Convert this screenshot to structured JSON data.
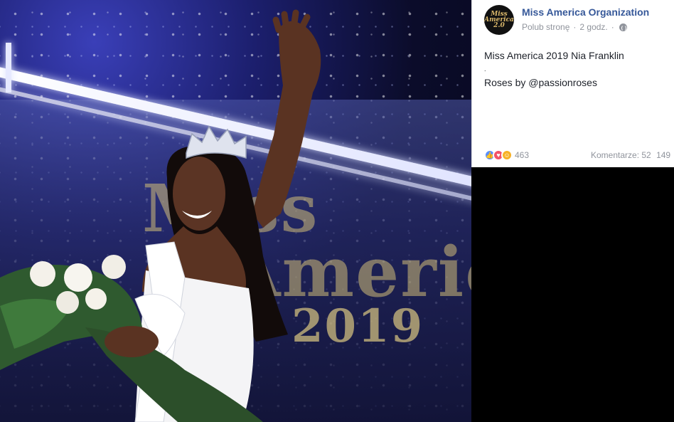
{
  "post": {
    "page_name": "Miss America Organization",
    "avatar_text": [
      "Miss",
      "America",
      "2.0"
    ],
    "like_page": "Polub stronę",
    "separator": "·",
    "time": "2 godz.",
    "privacy_icon": "globe-icon",
    "text_line1": "Miss America 2019 Nia Franklin",
    "text_line2": ".",
    "text_line3": "Roses by @passionroses",
    "reaction_icons": [
      "like-icon",
      "love-icon",
      "haha-icon"
    ],
    "reaction_count": "463",
    "comments_label": "Komentarze: 52",
    "shares_partial": "149"
  },
  "photo": {
    "stage_logo_line1": "Miss",
    "stage_logo_line2": "America",
    "stage_logo_year": "2019"
  },
  "colors": {
    "link_blue": "#365899",
    "meta_gray": "#90949c",
    "like_blue": "#5890ff",
    "love_red": "#f25268",
    "haha_yellow": "#f7b125"
  }
}
